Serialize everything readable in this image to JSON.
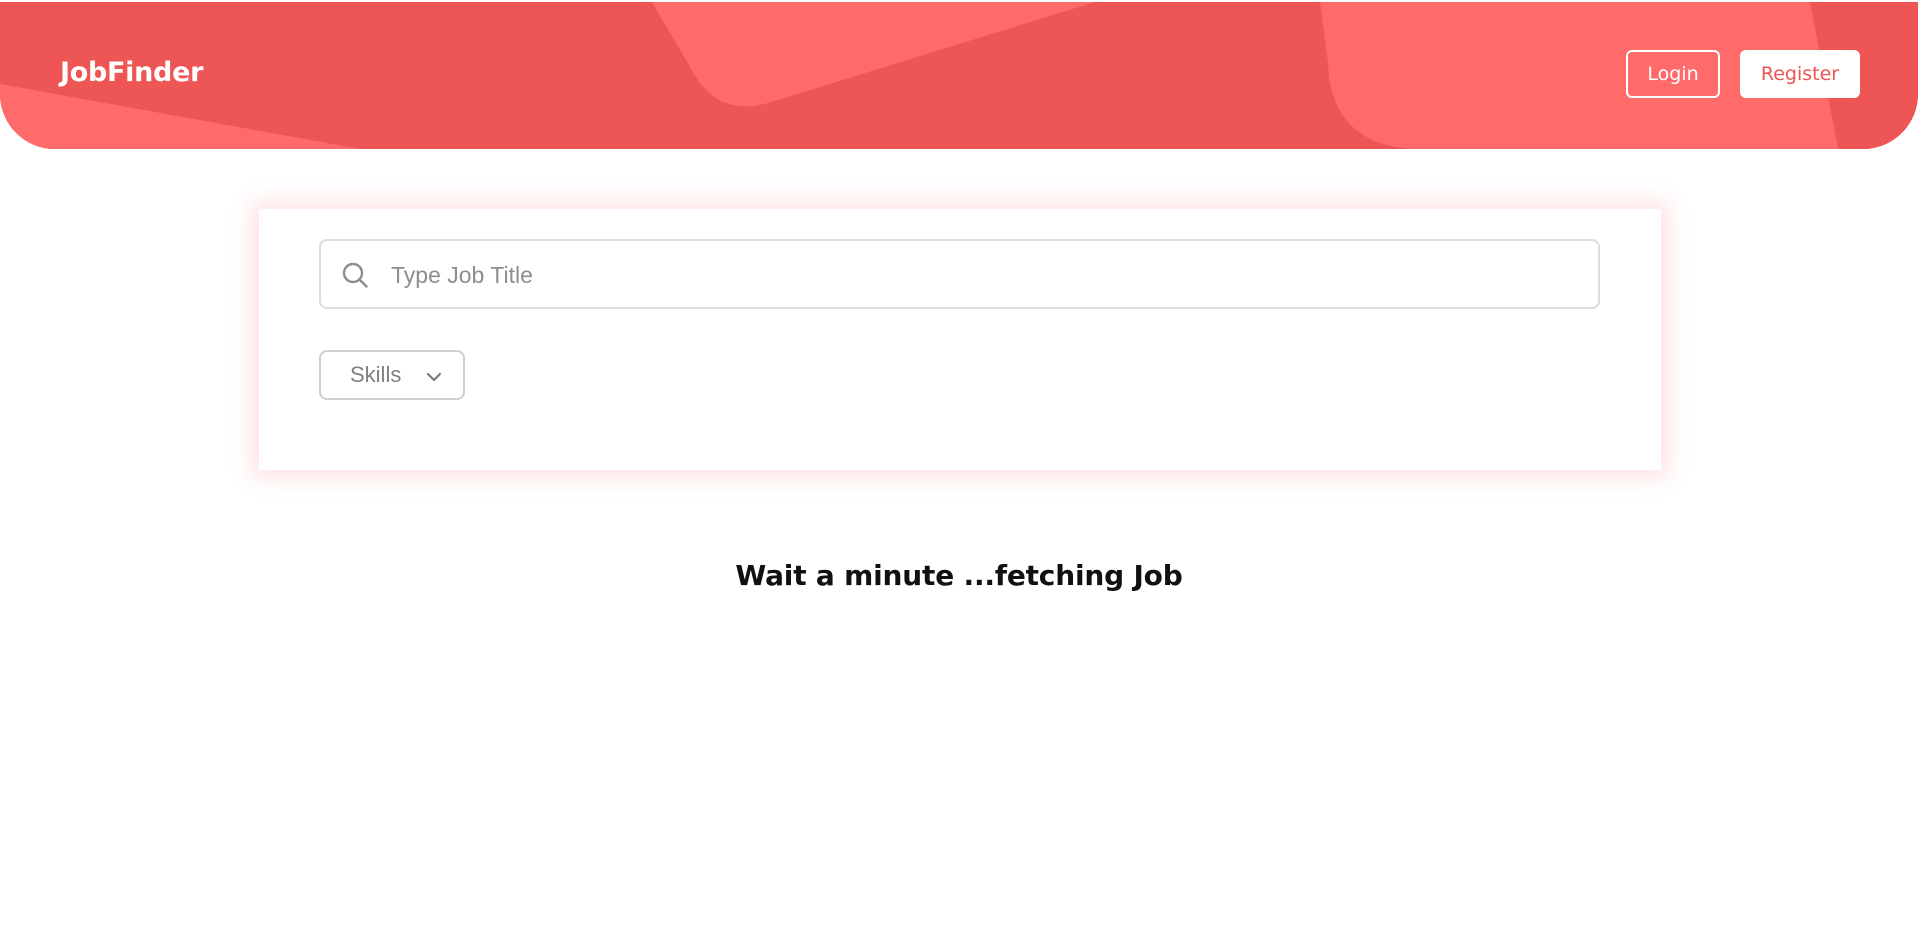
{
  "brand": {
    "name": "JobFinder",
    "accent_color": "#ed5555",
    "accent_light": "#ff6b6b"
  },
  "header": {
    "login_label": "Login",
    "register_label": "Register"
  },
  "search": {
    "icon": "search-icon",
    "placeholder": "Type Job Title",
    "value": ""
  },
  "filters": {
    "skills_label": "Skills",
    "skills_icon": "chevron-down-icon"
  },
  "status": {
    "message": "Wait a minute ...fetching Job"
  }
}
